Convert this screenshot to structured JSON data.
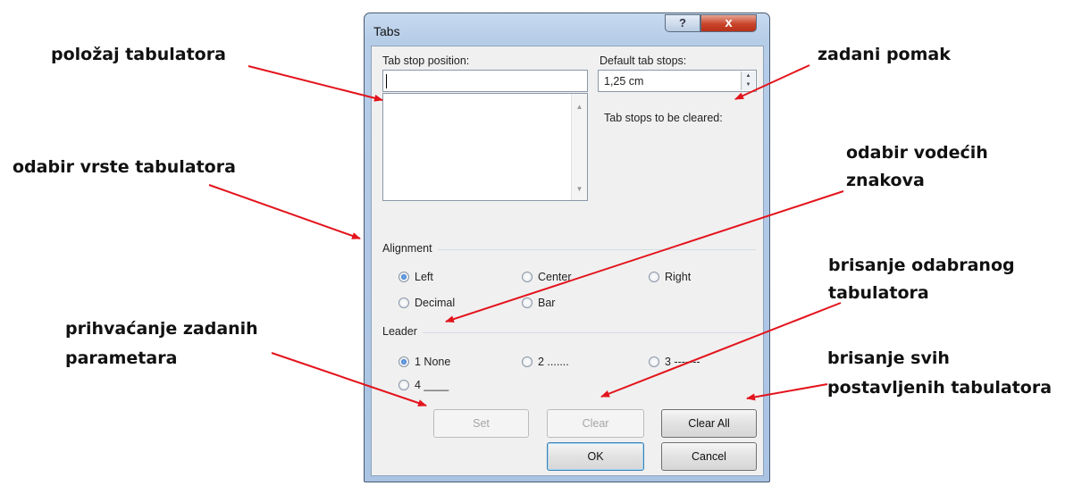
{
  "annotations": {
    "polozaj": "položaj tabulatora",
    "zadani_pomak": "zadani pomak",
    "odabir_vrste": "odabir vrste tabulatora",
    "vodecih_1": "odabir vodećih",
    "vodecih_2": "znakova",
    "brisanje_odabranog_1": "brisanje odabranog",
    "brisanje_odabranog_2": "tabulatora",
    "prihvacanje_1": "prihvaćanje zadanih",
    "prihvacanje_2": "parametara",
    "brisanje_svih_1": "brisanje svih",
    "brisanje_svih_2": "postavljenih tabulatora"
  },
  "dialog": {
    "title": "Tabs",
    "help_glyph": "?",
    "close_glyph": "x",
    "tab_stop_position_label": "Tab stop position:",
    "tab_stop_position_value": "",
    "default_tab_stops_label": "Default tab stops:",
    "default_tab_stops_value": "1,25 cm",
    "tab_stops_cleared_label": "Tab stops to be cleared:",
    "alignment_title": "Alignment",
    "alignment_options": [
      "Left",
      "Center",
      "Right",
      "Decimal",
      "Bar"
    ],
    "alignment_selected": "Left",
    "leader_title": "Leader",
    "leader_options": [
      "1 None",
      "2 .......",
      "3 -------",
      "4 ____"
    ],
    "leader_selected": "1 None",
    "set_label": "Set",
    "clear_label": "Clear",
    "clear_all_label": "Clear All",
    "ok_label": "OK",
    "cancel_label": "Cancel"
  },
  "colors": {
    "arrow": "#e3141c",
    "title_bar": "#b6cde8",
    "close_button": "#c8442a"
  }
}
